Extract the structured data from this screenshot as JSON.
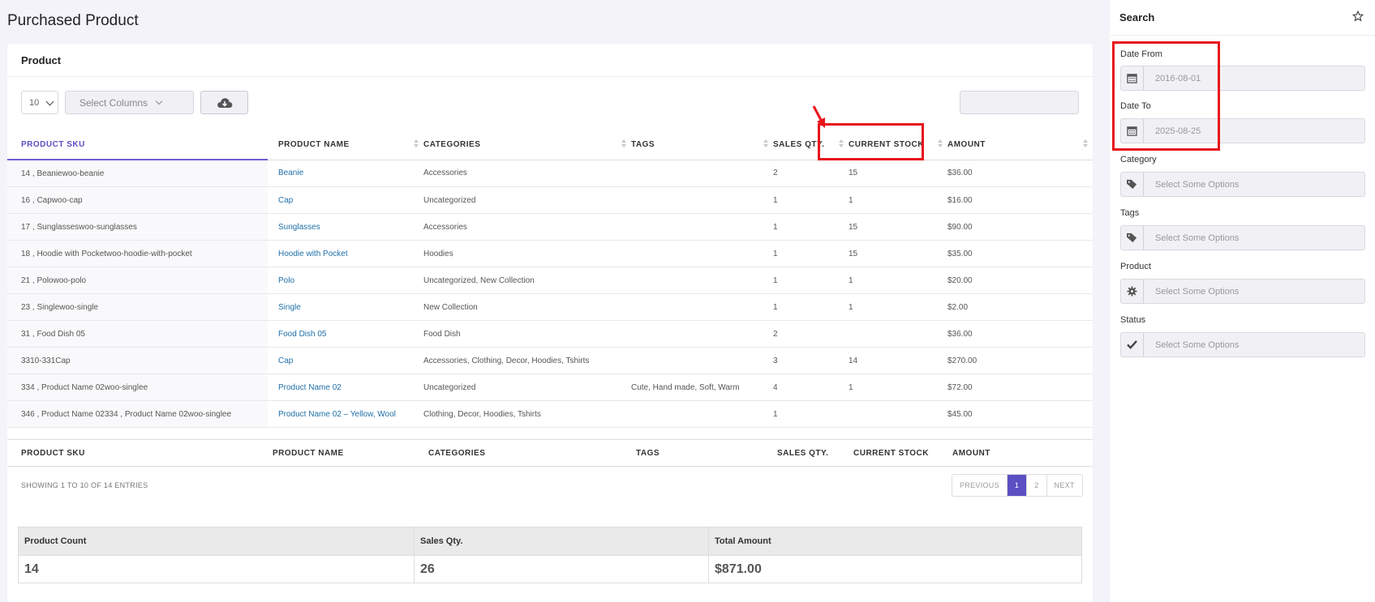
{
  "page": {
    "title": "Purchased Product"
  },
  "card": {
    "title": "Product"
  },
  "toolbar": {
    "page_length": "10",
    "select_columns": "Select Columns",
    "download_icon": "cloud-download-icon",
    "search_value": ""
  },
  "table": {
    "headers": [
      "PRODUCT SKU",
      "PRODUCT NAME",
      "CATEGORIES",
      "TAGS",
      "SALES QTY.",
      "CURRENT STOCK",
      "AMOUNT"
    ],
    "rows": [
      {
        "sku": "14 , Beaniewoo-beanie",
        "name": "Beanie",
        "categories": "Accessories",
        "tags": "",
        "qty": "2",
        "stock": "15",
        "amount": "$36.00"
      },
      {
        "sku": "16 , Capwoo-cap",
        "name": "Cap",
        "categories": "Uncategorized",
        "tags": "",
        "qty": "1",
        "stock": "1",
        "amount": "$16.00"
      },
      {
        "sku": "17 , Sunglasseswoo-sunglasses",
        "name": "Sunglasses",
        "categories": "Accessories",
        "tags": "",
        "qty": "1",
        "stock": "15",
        "amount": "$90.00"
      },
      {
        "sku": "18 , Hoodie with Pocketwoo-hoodie-with-pocket",
        "name": "Hoodie with Pocket",
        "categories": "Hoodies",
        "tags": "",
        "qty": "1",
        "stock": "15",
        "amount": "$35.00"
      },
      {
        "sku": "21 , Polowoo-polo",
        "name": "Polo",
        "categories": "Uncategorized, New Collection",
        "tags": "",
        "qty": "1",
        "stock": "1",
        "amount": "$20.00"
      },
      {
        "sku": "23 , Singlewoo-single",
        "name": "Single",
        "categories": "New Collection",
        "tags": "",
        "qty": "1",
        "stock": "1",
        "amount": "$2.00"
      },
      {
        "sku": "31 , Food Dish 05",
        "name": "Food Dish 05",
        "categories": "Food Dish",
        "tags": "",
        "qty": "2",
        "stock": "",
        "amount": "$36.00"
      },
      {
        "sku": "3310-331Cap",
        "name": "Cap",
        "categories": "Accessories, Clothing, Decor, Hoodies, Tshirts",
        "tags": "",
        "qty": "3",
        "stock": "14",
        "amount": "$270.00"
      },
      {
        "sku": "334 , Product Name 02woo-singlee",
        "name": "Product Name 02",
        "categories": "Uncategorized",
        "tags": "Cute, Hand made, Soft, Warm",
        "qty": "4",
        "stock": "1",
        "amount": "$72.00"
      },
      {
        "sku": "346 , Product Name 02334 , Product Name 02woo-singlee",
        "name": "Product Name 02 – Yellow, Wool",
        "categories": "Clothing, Decor, Hoodies, Tshirts",
        "tags": "",
        "qty": "1",
        "stock": "",
        "amount": "$45.00"
      }
    ],
    "footer": [
      "PRODUCT SKU",
      "PRODUCT NAME",
      "CATEGORIES",
      "TAGS",
      "SALES QTY.",
      "CURRENT STOCK",
      "AMOUNT"
    ]
  },
  "pagination": {
    "info": "SHOWING 1 TO 10 OF 14 ENTRIES",
    "previous": "PREVIOUS",
    "pages": [
      "1",
      "2"
    ],
    "current": "1",
    "next": "NEXT"
  },
  "summary": {
    "headers": [
      "Product Count",
      "Sales Qty.",
      "Total Amount"
    ],
    "values": [
      "14",
      "26",
      "$871.00"
    ]
  },
  "sidebar": {
    "title": "Search",
    "date_from_label": "Date From",
    "date_from_value": "2016-08-01",
    "date_to_label": "Date To",
    "date_to_value": "2025-08-25",
    "category_label": "Category",
    "category_placeholder": "Select Some Options",
    "tags_label": "Tags",
    "tags_placeholder": "Select Some Options",
    "product_label": "Product",
    "product_placeholder": "Select Some Options",
    "status_label": "Status",
    "status_placeholder": "Select Some Options"
  },
  "colors": {
    "accent": "#5b4fc4",
    "link": "#1f6fa8",
    "highlight": "#e8141c"
  }
}
